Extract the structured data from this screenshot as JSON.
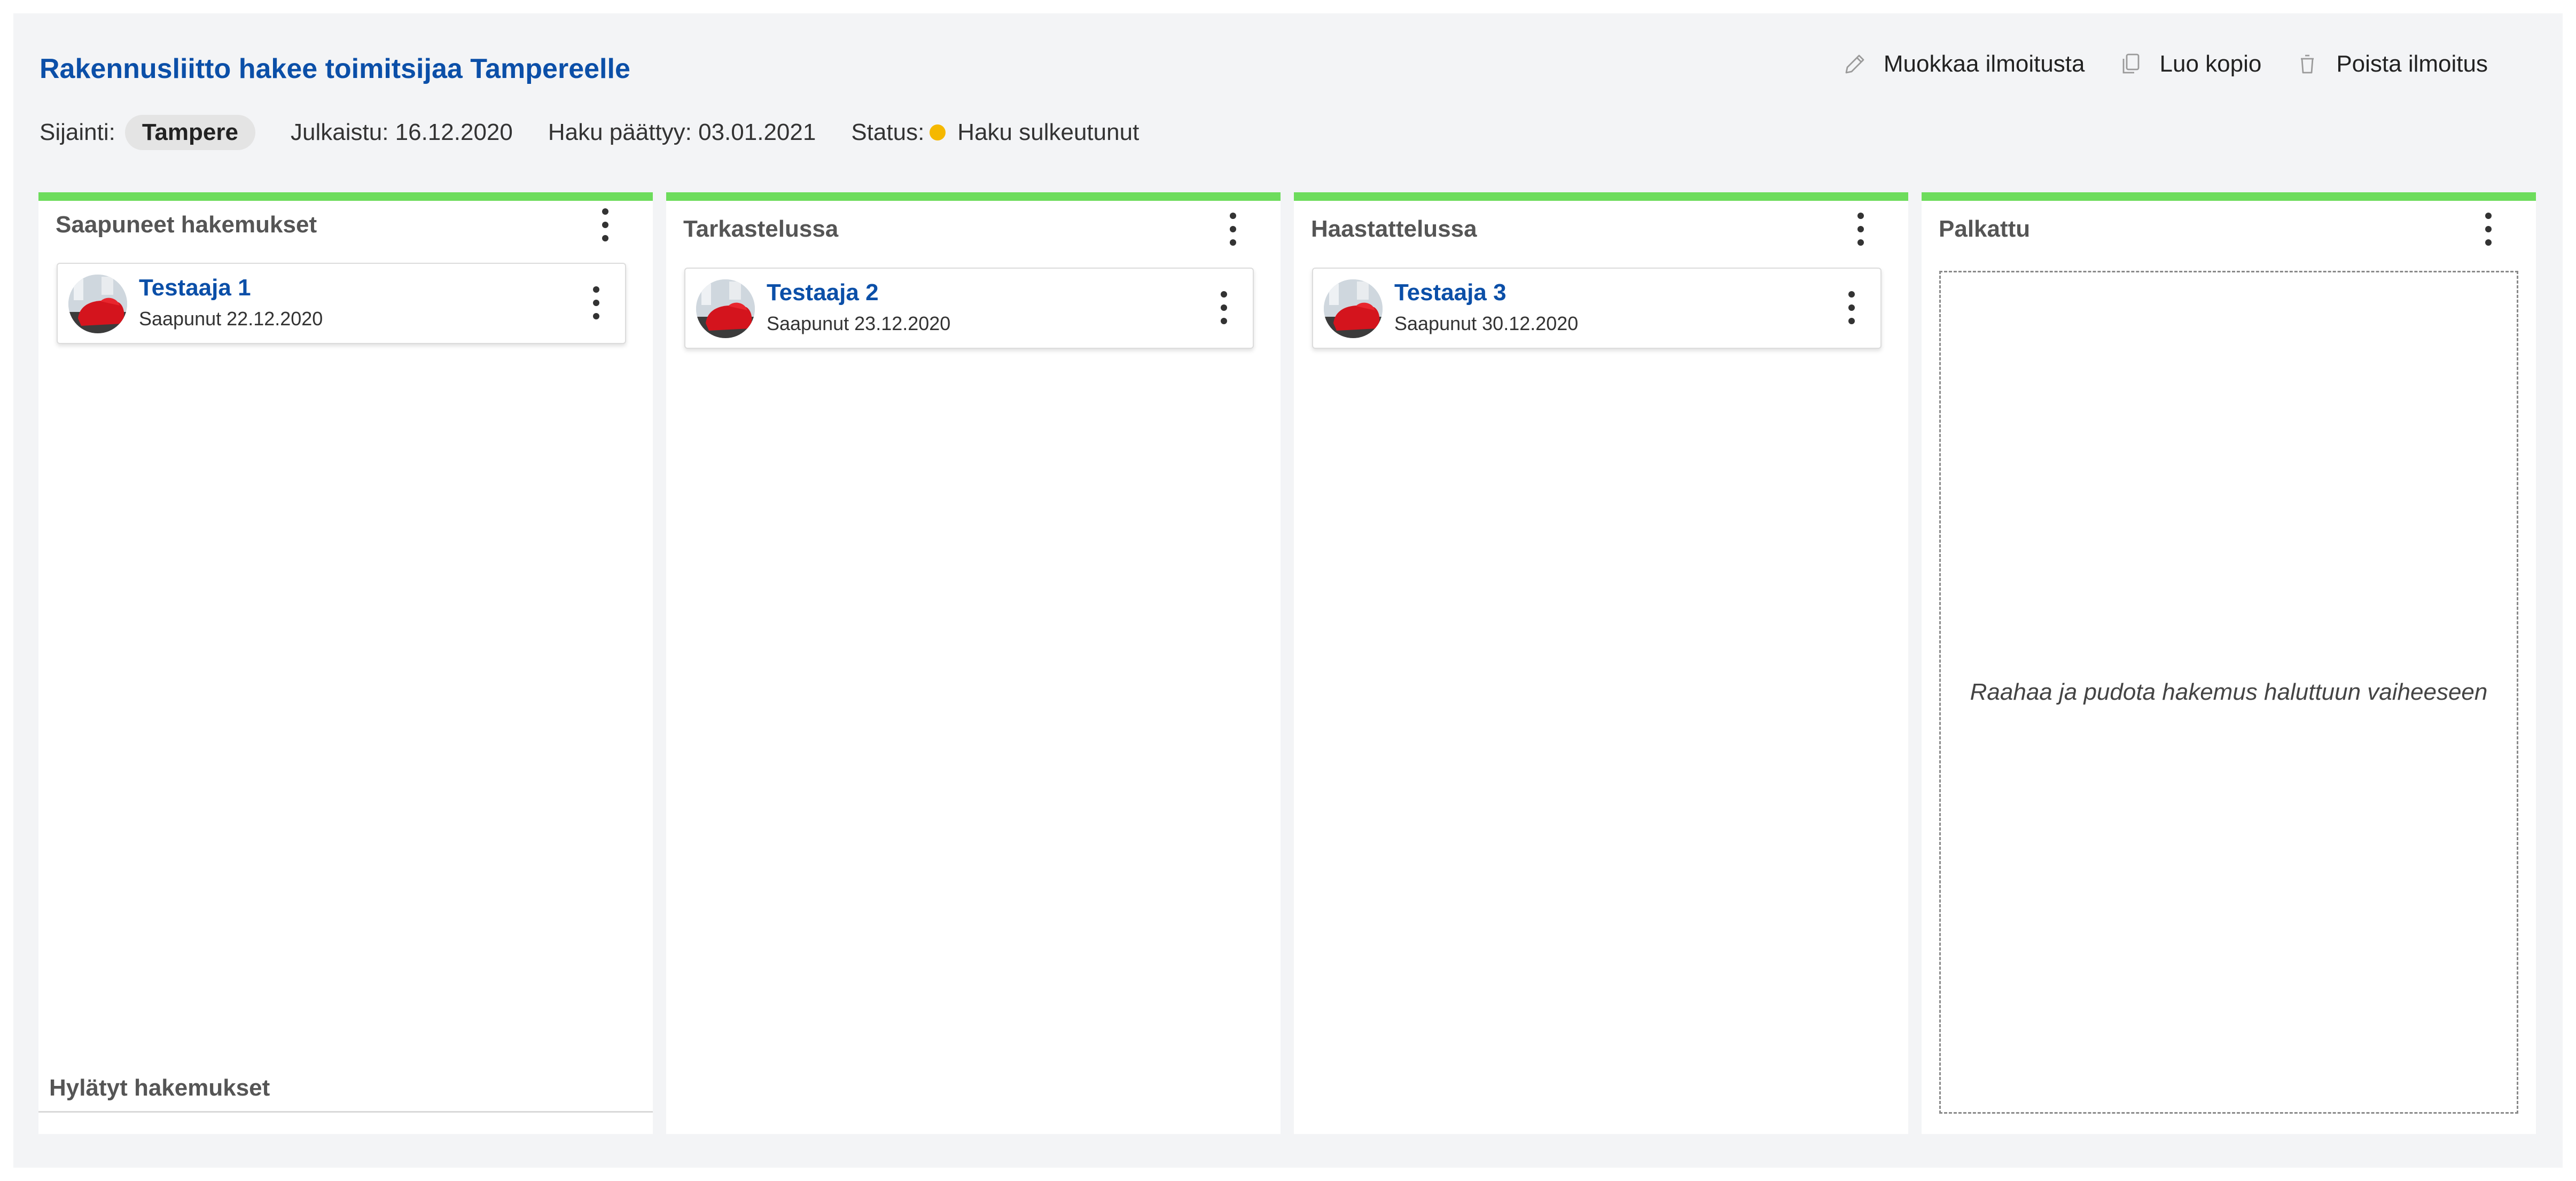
{
  "posting": {
    "title": "Rakennusliitto hakee toimitsijaa Tampereelle",
    "location_label": "Sijainti:",
    "location": "Tampere",
    "published": "Julkaistu: 16.12.2020",
    "deadline": "Haku päättyy: 03.01.2021",
    "status_label": "Status:",
    "status": "Haku sulkeutunut",
    "status_color": "#f5b800"
  },
  "actions": {
    "edit": "Muokkaa ilmoitusta",
    "copy": "Luo kopio",
    "delete": "Poista ilmoitus"
  },
  "columns": [
    {
      "title": "Saapuneet hakemukset",
      "cards": [
        {
          "name": "Testaaja 1",
          "date": "Saapunut 22.12.2020"
        }
      ],
      "footer": "Hylätyt hakemukset"
    },
    {
      "title": "Tarkastelussa",
      "cards": [
        {
          "name": "Testaaja 2",
          "date": "Saapunut 23.12.2020"
        }
      ]
    },
    {
      "title": "Haastattelussa",
      "cards": [
        {
          "name": "Testaaja 3",
          "date": "Saapunut 30.12.2020"
        }
      ]
    },
    {
      "title": "Palkattu",
      "empty_hint": "Raahaa ja pudota hakemus haluttuun vaiheeseen"
    }
  ],
  "colors": {
    "accent": "#0b4fa8",
    "column_top": "#6ddc5c",
    "background": "#f3f4f6"
  }
}
